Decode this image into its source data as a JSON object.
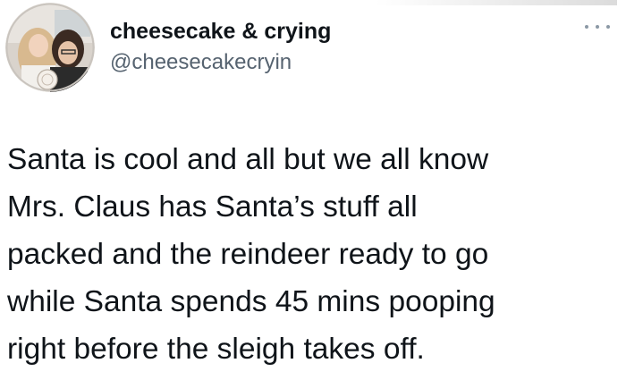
{
  "author": {
    "display_name": "cheesecake & crying",
    "handle": "@cheesecakecryin",
    "avatar_icon": "profile-photo-icon"
  },
  "menu": {
    "icon": "more-options-icon"
  },
  "tweet": {
    "lines": [
      "Santa is cool and all but we all know",
      "Mrs. Claus has Santa’s stuff all",
      "packed and the reindeer ready to go",
      "while Santa spends 45 mins pooping",
      "right before the sleigh takes off."
    ]
  },
  "colors": {
    "text": "#0f1419",
    "secondary": "#566370",
    "background": "#ffffff"
  }
}
